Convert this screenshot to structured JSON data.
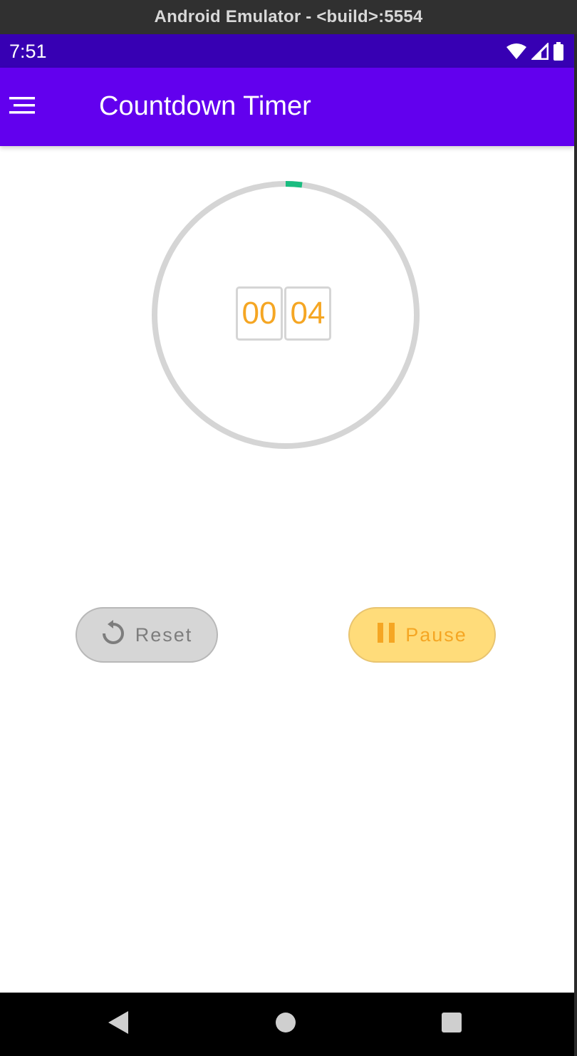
{
  "window": {
    "title": "Android Emulator - <build>:5554"
  },
  "status_bar": {
    "time": "7:51",
    "icons": [
      "wifi-icon",
      "signal-icon",
      "battery-icon"
    ]
  },
  "app_bar": {
    "title": "Countdown Timer",
    "menu_icon": "menu-icon",
    "color": "#6200ee"
  },
  "timer": {
    "minutes": "00",
    "seconds": "04",
    "progress_fraction": 0.02,
    "progress_color": "#1abc80",
    "track_color": "#d5d5d5",
    "digit_color": "#f5a623"
  },
  "buttons": {
    "reset_label": "Reset",
    "reset_icon": "reset-icon",
    "pause_label": "Pause",
    "pause_icon": "pause-icon"
  },
  "nav_bar": {
    "icons": [
      "back-icon",
      "home-icon",
      "recents-icon"
    ]
  }
}
